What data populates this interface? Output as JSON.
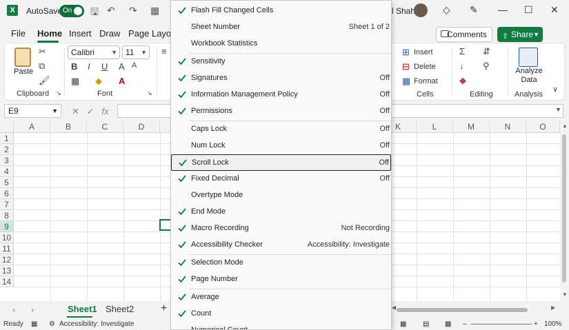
{
  "title_bar": {
    "autosave_label": "AutoSave",
    "autosave_toggle": "On",
    "user_name_fragment": "l Shah"
  },
  "tabs": [
    "File",
    "Home",
    "Insert",
    "Draw",
    "Page Layout"
  ],
  "active_tab": "Home",
  "buttons": {
    "comments": "Comments",
    "share": "Share"
  },
  "ribbon": {
    "clipboard": {
      "paste": "Paste",
      "label": "Clipboard"
    },
    "font": {
      "name": "Calibri",
      "size": "11",
      "label": "Font"
    },
    "cells": {
      "insert": "Insert",
      "delete": "Delete",
      "format": "Format",
      "label": "Cells"
    },
    "editing": {
      "label": "Editing"
    },
    "analysis": {
      "analyze_data_line1": "Analyze",
      "analyze_data_line2": "Data",
      "label": "Analysis"
    }
  },
  "formula_bar": {
    "name_box": "E9",
    "fx": "fx"
  },
  "grid": {
    "columns_left": [
      "A",
      "B",
      "C",
      "D"
    ],
    "columns_right": [
      "K",
      "L",
      "M",
      "N",
      "O"
    ],
    "rows": [
      "1",
      "2",
      "3",
      "4",
      "5",
      "6",
      "7",
      "8",
      "9",
      "10",
      "11",
      "12",
      "13",
      "14"
    ],
    "selected_row": "9"
  },
  "sheets": [
    "Sheet1",
    "Sheet2"
  ],
  "active_sheet": "Sheet1",
  "status_bar": {
    "ready": "Ready",
    "accessibility": "Accessibility: Investigate",
    "zoom": "100%"
  },
  "context_menu": {
    "items": [
      {
        "label": "Flash Fill Changed Cells",
        "value": "",
        "checked": true
      },
      {
        "label": "Sheet Number",
        "value": "Sheet 1 of 2",
        "checked": false
      },
      {
        "label": "Workbook Statistics",
        "value": "",
        "checked": false
      },
      {
        "label": "Sensitivity",
        "value": "",
        "checked": true
      },
      {
        "label": "Signatures",
        "value": "Off",
        "checked": true
      },
      {
        "label": "Information Management Policy",
        "value": "Off",
        "checked": true
      },
      {
        "label": "Permissions",
        "value": "Off",
        "checked": true
      },
      {
        "label": "Caps Lock",
        "value": "Off",
        "checked": false
      },
      {
        "label": "Num Lock",
        "value": "Off",
        "checked": false
      },
      {
        "label": "Scroll Lock",
        "value": "Off",
        "checked": true
      },
      {
        "label": "Fixed Decimal",
        "value": "Off",
        "checked": true
      },
      {
        "label": "Overtype Mode",
        "value": "",
        "checked": false
      },
      {
        "label": "End Mode",
        "value": "",
        "checked": true
      },
      {
        "label": "Macro Recording",
        "value": "Not Recording",
        "checked": true
      },
      {
        "label": "Accessibility Checker",
        "value": "Accessibility: Investigate",
        "checked": true
      },
      {
        "label": "Selection Mode",
        "value": "",
        "checked": true
      },
      {
        "label": "Page Number",
        "value": "",
        "checked": true
      },
      {
        "label": "Average",
        "value": "",
        "checked": true
      },
      {
        "label": "Count",
        "value": "",
        "checked": true
      },
      {
        "label": "Numerical Count",
        "value": "",
        "checked": false
      }
    ],
    "hovered_item": "Scroll Lock"
  },
  "colors": {
    "accent": "#107c41",
    "check": "#107c41"
  }
}
